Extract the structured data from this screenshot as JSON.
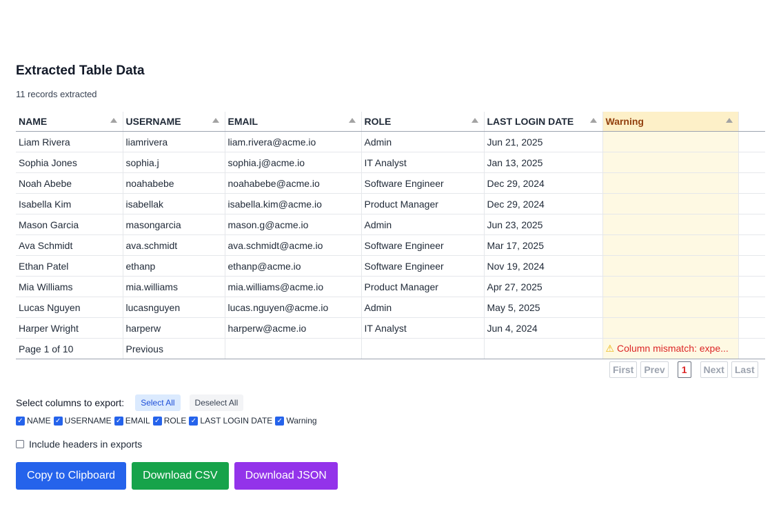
{
  "header": {
    "title": "Extracted Table Data",
    "subtitle": "11 records extracted"
  },
  "table": {
    "columns": [
      "NAME",
      "USERNAME",
      "EMAIL",
      "ROLE",
      "LAST LOGIN DATE",
      "Warning"
    ],
    "rows": [
      [
        "Liam Rivera",
        "liamrivera",
        "liam.rivera@acme.io",
        "Admin",
        "Jun 21, 2025",
        ""
      ],
      [
        "Sophia Jones",
        "sophia.j",
        "sophia.j@acme.io",
        "IT Analyst",
        "Jan 13, 2025",
        ""
      ],
      [
        "Noah Abebe",
        "noahabebe",
        "noahabebe@acme.io",
        "Software Engineer",
        "Dec 29, 2024",
        ""
      ],
      [
        "Isabella Kim",
        "isabellak",
        "isabella.kim@acme.io",
        "Product Manager",
        "Dec 29, 2024",
        ""
      ],
      [
        "Mason Garcia",
        "masongarcia",
        "mason.g@acme.io",
        "Admin",
        "Jun 23, 2025",
        ""
      ],
      [
        "Ava Schmidt",
        "ava.schmidt",
        "ava.schmidt@acme.io",
        "Software Engineer",
        "Mar 17, 2025",
        ""
      ],
      [
        "Ethan Patel",
        "ethanp",
        "ethanp@acme.io",
        "Software Engineer",
        "Nov 19, 2024",
        ""
      ],
      [
        "Mia Williams",
        "mia.williams",
        "mia.williams@acme.io",
        "Product Manager",
        "Apr 27, 2025",
        ""
      ],
      [
        "Lucas Nguyen",
        "lucasnguyen",
        "lucas.nguyen@acme.io",
        "Admin",
        "May 5, 2025",
        ""
      ],
      [
        "Harper Wright",
        "harperw",
        "harperw@acme.io",
        "IT Analyst",
        "Jun 4, 2024",
        ""
      ]
    ],
    "footer_row": [
      "Page 1 of 10",
      "Previous",
      "",
      "",
      "",
      "Column mismatch: expe..."
    ],
    "warning_icon": "warning-triangle-icon",
    "warning_color": "#dc2626",
    "warning_column_color": "#fdf0c8"
  },
  "pagination": {
    "first": "First",
    "prev": "Prev",
    "current": "1",
    "next": "Next",
    "last": "Last"
  },
  "export": {
    "select_label": "Select columns to export:",
    "select_all": "Select All",
    "deselect_all": "Deselect All",
    "columns": [
      "NAME",
      "USERNAME",
      "EMAIL",
      "ROLE",
      "LAST LOGIN DATE",
      "Warning"
    ],
    "include_headers_label": "Include headers in exports",
    "include_headers_checked": false
  },
  "actions": {
    "copy": "Copy to Clipboard",
    "csv": "Download CSV",
    "json": "Download JSON",
    "colors": {
      "copy": "#2563eb",
      "csv": "#16a34a",
      "json": "#9333ea"
    }
  }
}
